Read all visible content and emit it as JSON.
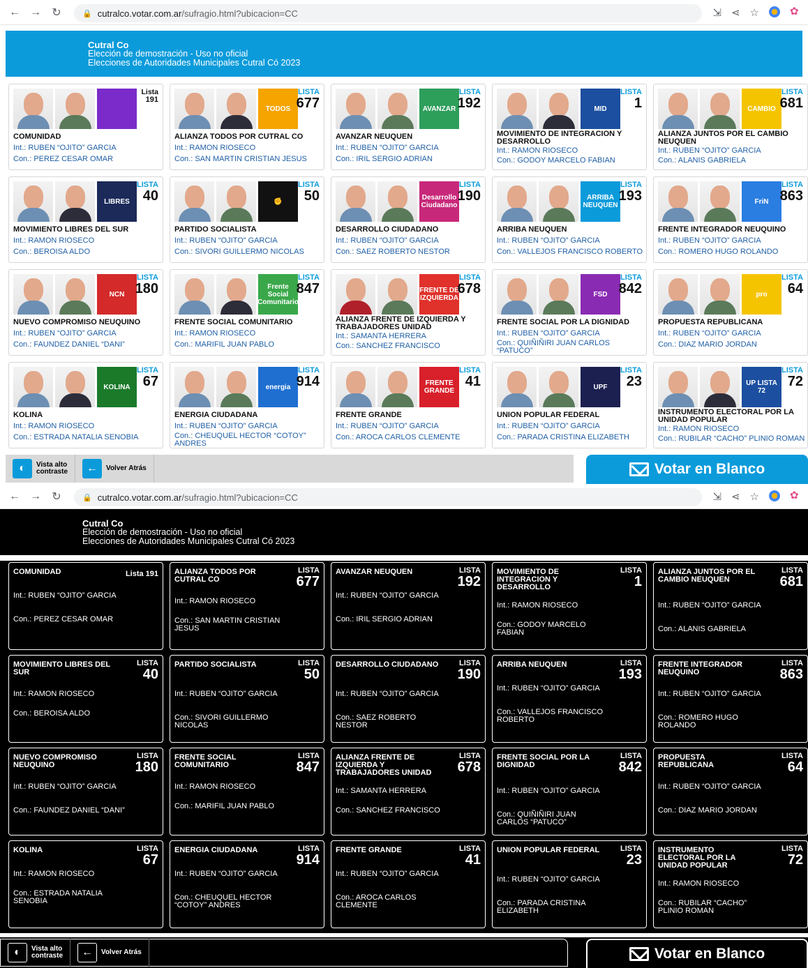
{
  "browser": {
    "domain": "cutralco.votar.com.ar",
    "path": "/sufragio.html?ubicacion=CC"
  },
  "banner": {
    "title": "Cutral Co",
    "line1": "Elección de demostración - Uso no oficial",
    "line2": "Elecciones de Autoridades Municipales Cutral Có 2023"
  },
  "lista_label": "LISTA",
  "parties": [
    {
      "name": "COMUNIDAD",
      "lista": "191",
      "lista_label": "Lista",
      "int": "Int.: RUBEN “OJITO” GARCIA",
      "con": "Con.: PEREZ CESAR OMAR",
      "logo": "comunidad-logo",
      "logo_color": "#7a2bc9"
    },
    {
      "name": "ALIANZA TODOS POR CUTRAL CO",
      "lista": "677",
      "int": "Int.: RAMON RIOSECO",
      "con": "Con.: SAN MARTIN CRISTIAN JESUS",
      "logo_text": "TODOS",
      "logo_color": "#f5a400"
    },
    {
      "name": "AVANZAR NEUQUEN",
      "lista": "192",
      "int": "Int.: RUBEN “OJITO” GARCIA",
      "con": "Con.: IRIL SERGIO ADRIAN",
      "logo_text": "AVANZAR",
      "logo_color": "#2e9e5b"
    },
    {
      "name": "MOVIMIENTO DE INTEGRACION Y DESARROLLO",
      "lista": "1",
      "int": "Int.: RAMON RIOSECO",
      "con": "Con.: GODOY MARCELO FABIAN",
      "logo_text": "MID",
      "logo_color": "#1c4fa0"
    },
    {
      "name": "ALIANZA JUNTOS POR EL CAMBIO NEUQUEN",
      "lista": "681",
      "int": "Int.: RUBEN “OJITO” GARCIA",
      "con": "Con.: ALANIS GABRIELA",
      "logo_text": "CAMBIO",
      "logo_color": "#f5c400"
    },
    {
      "name": "MOVIMIENTO LIBRES DEL SUR",
      "lista": "40",
      "int": "Int.: RAMON RIOSECO",
      "con": "Con.: BEROISA ALDO",
      "logo_text": "LIBRES",
      "logo_color": "#1c2a5a"
    },
    {
      "name": "PARTIDO SOCIALISTA",
      "lista": "50",
      "int": "Int.: RUBEN “OJITO” GARCIA",
      "con": "Con.: SIVORI GUILLERMO NICOLAS",
      "logo_text": "✊",
      "logo_color": "#111111"
    },
    {
      "name": "DESARROLLO CIUDADANO",
      "lista": "190",
      "int": "Int.: RUBEN “OJITO” GARCIA",
      "con": "Con.: SAEZ ROBERTO NESTOR",
      "logo_text": "Desarrollo Ciudadano",
      "logo_color": "#c8287a"
    },
    {
      "name": "ARRIBA NEUQUEN",
      "lista": "193",
      "int": "Int.: RUBEN “OJITO” GARCIA",
      "con": "Con.: VALLEJOS FRANCISCO ROBERTO",
      "logo_text": "ARRIBA NEUQUEN",
      "logo_color": "#0b9bdb"
    },
    {
      "name": "FRENTE INTEGRADOR NEUQUINO",
      "lista": "863",
      "int": "Int.: RUBEN “OJITO” GARCIA",
      "con": "Con.: ROMERO HUGO ROLANDO",
      "logo_text": "FriN",
      "logo_color": "#2a7de1"
    },
    {
      "name": "NUEVO COMPROMISO NEUQUINO",
      "lista": "180",
      "int": "Int.: RUBEN “OJITO” GARCIA",
      "con": "Con.: FAUNDEZ DANIEL “DANI”",
      "logo_text": "NCN",
      "logo_color": "#d42a2a"
    },
    {
      "name": "FRENTE SOCIAL COMUNITARIO",
      "lista": "847",
      "int": "Int.: RAMON RIOSECO",
      "con": "Con.: MARIFIL JUAN PABLO",
      "logo_text": "Frente Social Comunitario",
      "logo_color": "#3aa84a"
    },
    {
      "name": "ALIANZA FRENTE DE IZQUIERDA Y TRABAJADORES UNIDAD",
      "lista": "678",
      "int": "Int.: SAMANTA HERRERA",
      "con": "Con.: SANCHEZ FRANCISCO",
      "logo_text": "FRENTE DE IZQUIERDA",
      "logo_color": "#e0312b"
    },
    {
      "name": "FRENTE SOCIAL POR LA DIGNIDAD",
      "lista": "842",
      "int": "Int.: RUBEN “OJITO” GARCIA",
      "con": "Con.: QUIÑIÑIRI JUAN CARLOS “PATUCO”",
      "logo_text": "FSD",
      "logo_color": "#8a2bb3"
    },
    {
      "name": "PROPUESTA REPUBLICANA",
      "lista": "64",
      "int": "Int.: RUBEN “OJITO” GARCIA",
      "con": "Con.: DIAZ MARIO JORDAN",
      "logo_text": "pro",
      "logo_color": "#f5c400"
    },
    {
      "name": "KOLINA",
      "lista": "67",
      "int": "Int.: RAMON RIOSECO",
      "con": "Con.: ESTRADA NATALIA SENOBIA",
      "logo_text": "KOLINA",
      "logo_color": "#1a7a2a"
    },
    {
      "name": "ENERGIA CIUDADANA",
      "lista": "914",
      "int": "Int.: RUBEN “OJITO” GARCIA",
      "con": "Con.: CHEUQUEL HECTOR “COTOY” ANDRES",
      "logo_text": "energia",
      "logo_color": "#1f6fd1"
    },
    {
      "name": "FRENTE GRANDE",
      "lista": "41",
      "int": "Int.: RUBEN “OJITO” GARCIA",
      "con": "Con.: AROCA CARLOS CLEMENTE",
      "logo_text": "FRENTE GRANDE",
      "logo_color": "#d8202a"
    },
    {
      "name": "UNION POPULAR FEDERAL",
      "lista": "23",
      "int": "Int.: RUBEN “OJITO” GARCIA",
      "con": "Con.: PARADA CRISTINA ELIZABETH",
      "logo_text": "UPF",
      "logo_color": "#1c2050"
    },
    {
      "name": "INSTRUMENTO ELECTORAL POR LA UNIDAD POPULAR",
      "lista": "72",
      "int": "Int.: RAMON RIOSECO",
      "con": "Con.: RUBILAR “CACHO” PLINIO ROMAN",
      "logo_text": "UP LISTA 72",
      "logo_color": "#1c4fa0"
    }
  ],
  "footer": {
    "contrast_label_1": "Vista alto",
    "contrast_label_2": "contraste",
    "back_label": "Volver Atrás",
    "blank_vote_label": "Votar en Blanco"
  }
}
